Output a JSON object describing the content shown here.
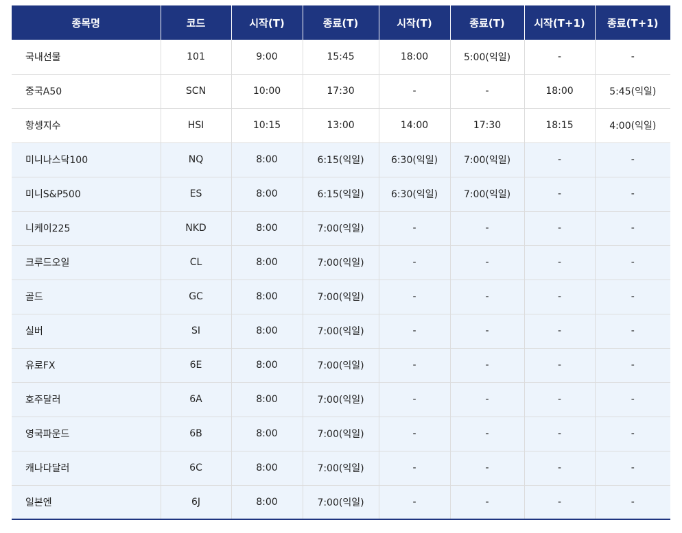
{
  "header": {
    "columns": [
      "종목명",
      "코드",
      "시작(T)",
      "종료(T)",
      "시작(T)",
      "종료(T)",
      "시작(T+1)",
      "종료(T+1)"
    ]
  },
  "rows": [
    {
      "name": "국내선물",
      "code": "101",
      "start_t": "9:00",
      "end_t": "15:45",
      "start_t2": "18:00",
      "end_t2": "5:00(익일)",
      "start_t1": "-",
      "end_t1": "-",
      "shaded": false
    },
    {
      "name": "중국A50",
      "code": "SCN",
      "start_t": "10:00",
      "end_t": "17:30",
      "start_t2": "-",
      "end_t2": "-",
      "start_t1": "18:00",
      "end_t1": "5:45(익일)",
      "shaded": false
    },
    {
      "name": "항셍지수",
      "code": "HSI",
      "start_t": "10:15",
      "end_t": "13:00",
      "start_t2": "14:00",
      "end_t2": "17:30",
      "start_t1": "18:15",
      "end_t1": "4:00(익일)",
      "shaded": false
    },
    {
      "name": "미니나스닥100",
      "code": "NQ",
      "start_t": "8:00",
      "end_t": "6:15(익일)",
      "start_t2": "6:30(익일)",
      "end_t2": "7:00(익일)",
      "start_t1": "-",
      "end_t1": "-",
      "shaded": true
    },
    {
      "name": "미니S&P500",
      "code": "ES",
      "start_t": "8:00",
      "end_t": "6:15(익일)",
      "start_t2": "6:30(익일)",
      "end_t2": "7:00(익일)",
      "start_t1": "-",
      "end_t1": "-",
      "shaded": true
    },
    {
      "name": "니케이225",
      "code": "NKD",
      "start_t": "8:00",
      "end_t": "7:00(익일)",
      "start_t2": "-",
      "end_t2": "-",
      "start_t1": "-",
      "end_t1": "-",
      "shaded": true
    },
    {
      "name": "크루드오일",
      "code": "CL",
      "start_t": "8:00",
      "end_t": "7:00(익일)",
      "start_t2": "-",
      "end_t2": "-",
      "start_t1": "-",
      "end_t1": "-",
      "shaded": true
    },
    {
      "name": "골드",
      "code": "GC",
      "start_t": "8:00",
      "end_t": "7:00(익일)",
      "start_t2": "-",
      "end_t2": "-",
      "start_t1": "-",
      "end_t1": "-",
      "shaded": true
    },
    {
      "name": "실버",
      "code": "SI",
      "start_t": "8:00",
      "end_t": "7:00(익일)",
      "start_t2": "-",
      "end_t2": "-",
      "start_t1": "-",
      "end_t1": "-",
      "shaded": true
    },
    {
      "name": "유로FX",
      "code": "6E",
      "start_t": "8:00",
      "end_t": "7:00(익일)",
      "start_t2": "-",
      "end_t2": "-",
      "start_t1": "-",
      "end_t1": "-",
      "shaded": true
    },
    {
      "name": "호주달러",
      "code": "6A",
      "start_t": "8:00",
      "end_t": "7:00(익일)",
      "start_t2": "-",
      "end_t2": "-",
      "start_t1": "-",
      "end_t1": "-",
      "shaded": true
    },
    {
      "name": "영국파운드",
      "code": "6B",
      "start_t": "8:00",
      "end_t": "7:00(익일)",
      "start_t2": "-",
      "end_t2": "-",
      "start_t1": "-",
      "end_t1": "-",
      "shaded": true
    },
    {
      "name": "캐나다달러",
      "code": "6C",
      "start_t": "8:00",
      "end_t": "7:00(익일)",
      "start_t2": "-",
      "end_t2": "-",
      "start_t1": "-",
      "end_t1": "-",
      "shaded": true
    },
    {
      "name": "일본엔",
      "code": "6J",
      "start_t": "8:00",
      "end_t": "7:00(익일)",
      "start_t2": "-",
      "end_t2": "-",
      "start_t1": "-",
      "end_t1": "-",
      "shaded": true
    }
  ],
  "colors": {
    "header_bg": "#1e3580",
    "header_text": "#ffffff",
    "shaded_row_bg": "#edf4fc",
    "row_border": "#dcdcdc"
  }
}
